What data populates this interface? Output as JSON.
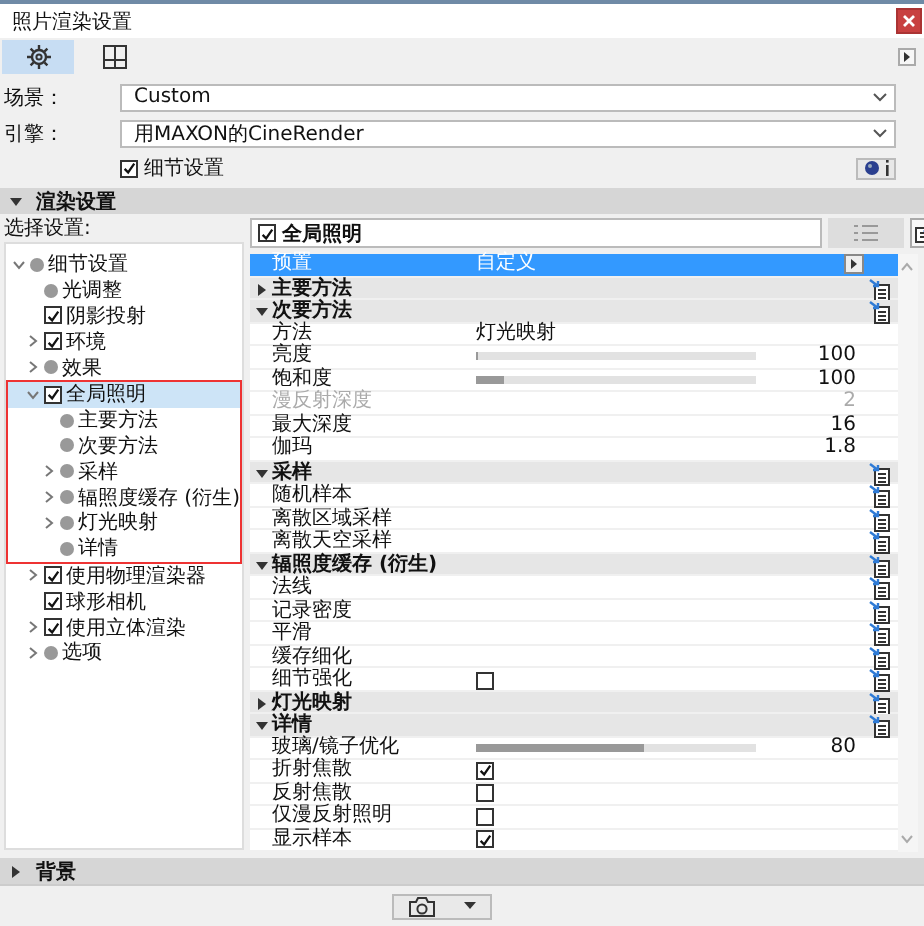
{
  "window": {
    "title": "照片渲染设置"
  },
  "tabs": [
    {
      "selected": true
    },
    {
      "selected": false
    }
  ],
  "scene": {
    "label": "场景：",
    "value": "Custom"
  },
  "engine": {
    "label": "引擎：",
    "value": "用MAXON的CineRender"
  },
  "detail_settings": {
    "label": "细节设置",
    "checked": true
  },
  "render_section": {
    "title": "渲染设置",
    "expanded": true
  },
  "tree": {
    "label": "选择设置:",
    "items": [
      {
        "label": "细节设置",
        "kind": "dot",
        "expanded": true,
        "selected": false,
        "highlighted": false,
        "children": [
          {
            "label": "光调整",
            "kind": "dot",
            "selected": false,
            "highlighted": false
          },
          {
            "label": "阴影投射",
            "kind": "checkbox",
            "checked": true,
            "selected": false,
            "highlighted": false
          },
          {
            "label": "环境",
            "kind": "checkbox",
            "checked": true,
            "expanded": false,
            "selected": false,
            "highlighted": false
          },
          {
            "label": "效果",
            "kind": "dot",
            "expanded": false,
            "selected": false,
            "highlighted": false
          },
          {
            "label": "全局照明",
            "kind": "checkbox",
            "checked": true,
            "expanded": true,
            "selected": true,
            "highlighted": true,
            "children": [
              {
                "label": "主要方法",
                "kind": "dot",
                "selected": false,
                "highlighted": false
              },
              {
                "label": "次要方法",
                "kind": "dot",
                "selected": false,
                "highlighted": false
              },
              {
                "label": "采样",
                "kind": "dot",
                "expanded": false,
                "selected": false,
                "highlighted": false
              },
              {
                "label": "辐照度缓存 (衍生)",
                "kind": "dot",
                "expanded": false,
                "selected": false,
                "highlighted": false
              },
              {
                "label": "灯光映射",
                "kind": "dot",
                "expanded": false,
                "selected": false,
                "highlighted": false
              },
              {
                "label": "详情",
                "kind": "dot",
                "selected": false,
                "highlighted": false
              }
            ]
          },
          {
            "label": "使用物理渲染器",
            "kind": "checkbox",
            "checked": true,
            "expanded": false,
            "selected": false,
            "highlighted": false
          },
          {
            "label": "球形相机",
            "kind": "checkbox",
            "checked": true,
            "selected": false,
            "highlighted": false
          },
          {
            "label": "使用立体渲染",
            "kind": "checkbox",
            "checked": true,
            "expanded": false,
            "selected": false,
            "highlighted": false
          },
          {
            "label": "选项",
            "kind": "dot",
            "expanded": false,
            "selected": false,
            "highlighted": false
          }
        ]
      }
    ]
  },
  "panel": {
    "label": "全局照明",
    "checked": true
  },
  "properties": [
    {
      "kind": "preset",
      "label": "预置",
      "value": "自定义",
      "selected": true,
      "linked": false,
      "disabled": false
    },
    {
      "kind": "group",
      "label": "主要方法",
      "expanded": false,
      "selected": false,
      "linked": true,
      "disabled": false
    },
    {
      "kind": "group",
      "label": "次要方法",
      "expanded": true,
      "selected": false,
      "linked": true,
      "disabled": false
    },
    {
      "kind": "text",
      "label": "方法",
      "value": "灯光映射",
      "selected": false,
      "linked": false,
      "disabled": false
    },
    {
      "kind": "slider",
      "label": "亮度",
      "level": 0.01,
      "reading": "100",
      "selected": false,
      "linked": false,
      "disabled": false
    },
    {
      "kind": "slider",
      "label": "饱和度",
      "level": 0.1,
      "reading": "100",
      "selected": false,
      "linked": false,
      "disabled": false
    },
    {
      "kind": "number",
      "label": "漫反射深度",
      "reading": "2",
      "selected": false,
      "linked": false,
      "disabled": true
    },
    {
      "kind": "number",
      "label": "最大深度",
      "reading": "16",
      "selected": false,
      "linked": false,
      "disabled": false
    },
    {
      "kind": "number",
      "label": "伽玛",
      "reading": "1.8",
      "selected": false,
      "linked": false,
      "disabled": false
    },
    {
      "kind": "group",
      "label": "采样",
      "expanded": true,
      "selected": false,
      "linked": true,
      "disabled": false
    },
    {
      "kind": "plain",
      "label": "随机样本",
      "selected": false,
      "linked": true,
      "disabled": false
    },
    {
      "kind": "plain",
      "label": "离散区域采样",
      "selected": false,
      "linked": true,
      "disabled": false
    },
    {
      "kind": "plain",
      "label": "离散天空采样",
      "selected": false,
      "linked": true,
      "disabled": false
    },
    {
      "kind": "group",
      "label": "辐照度缓存 (衍生)",
      "expanded": true,
      "selected": false,
      "linked": true,
      "disabled": false
    },
    {
      "kind": "plain",
      "label": "法线",
      "selected": false,
      "linked": true,
      "disabled": false
    },
    {
      "kind": "plain",
      "label": "记录密度",
      "selected": false,
      "linked": true,
      "disabled": false
    },
    {
      "kind": "plain",
      "label": "平滑",
      "selected": false,
      "linked": true,
      "disabled": false
    },
    {
      "kind": "plain",
      "label": "缓存细化",
      "selected": false,
      "linked": true,
      "disabled": false
    },
    {
      "kind": "checkbox",
      "label": "细节强化",
      "checked": false,
      "selected": false,
      "linked": true,
      "disabled": false
    },
    {
      "kind": "group",
      "label": "灯光映射",
      "expanded": false,
      "selected": false,
      "linked": true,
      "disabled": false
    },
    {
      "kind": "group",
      "label": "详情",
      "expanded": true,
      "selected": false,
      "linked": true,
      "disabled": false
    },
    {
      "kind": "slider",
      "label": "玻璃/镜子优化",
      "level": 0.6,
      "reading": "80",
      "selected": false,
      "linked": false,
      "disabled": false
    },
    {
      "kind": "checkbox",
      "label": "折射焦散",
      "checked": true,
      "selected": false,
      "linked": false,
      "disabled": false
    },
    {
      "kind": "checkbox",
      "label": "反射焦散",
      "checked": false,
      "selected": false,
      "linked": false,
      "disabled": false
    },
    {
      "kind": "checkbox",
      "label": "仅漫反射照明",
      "checked": false,
      "selected": false,
      "linked": false,
      "disabled": false
    },
    {
      "kind": "checkbox",
      "label": "显示样本",
      "checked": true,
      "selected": false,
      "linked": false,
      "disabled": false
    }
  ],
  "background_section": {
    "title": "背景",
    "expanded": false
  }
}
